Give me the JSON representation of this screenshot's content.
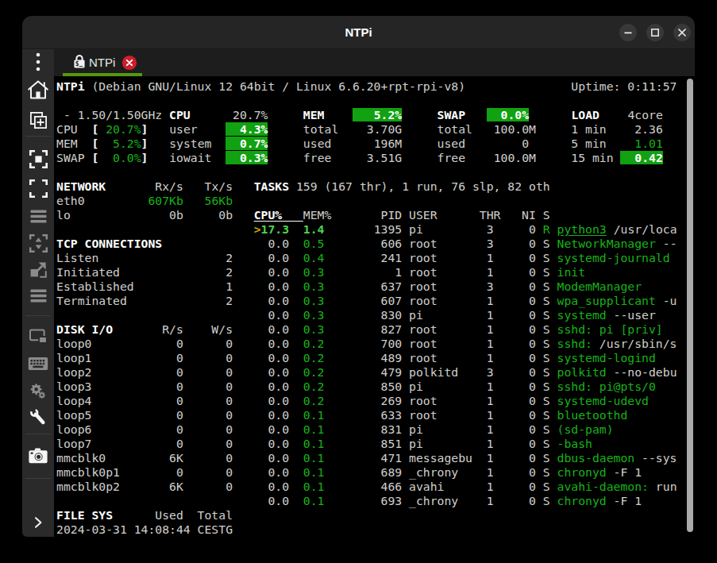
{
  "window": {
    "title": "NTPi"
  },
  "titlebar": {
    "buttons": [
      {
        "id": "minimize",
        "glyph": "minus"
      },
      {
        "id": "maximize",
        "glyph": "square"
      },
      {
        "id": "close",
        "glyph": "cross"
      }
    ]
  },
  "sidebar": {
    "tools": [
      {
        "id": "kebab-menu",
        "enabled": true
      },
      {
        "id": "home",
        "enabled": true
      },
      {
        "id": "duplicate-connection",
        "enabled": true
      },
      {
        "id": "fit-window",
        "enabled": true
      },
      {
        "id": "fullscreen",
        "enabled": true
      },
      {
        "id": "multi-monitor-lines",
        "enabled": false
      },
      {
        "id": "dynamic-resolution",
        "enabled": false
      },
      {
        "id": "scaled-mode",
        "enabled": false
      },
      {
        "id": "keystrokes-lines",
        "enabled": false
      },
      {
        "id": "switch-tab-pages",
        "enabled": false
      },
      {
        "id": "grab-keyboard",
        "enabled": false
      },
      {
        "id": "preferences-gears",
        "enabled": false
      },
      {
        "id": "tools-wrench",
        "enabled": true
      },
      {
        "id": "screenshot-camera",
        "enabled": true
      },
      {
        "id": "collapse-toolbar-chevron",
        "enabled": true
      }
    ]
  },
  "tabbar": {
    "tabs": [
      {
        "label": "NTPi",
        "icon": "ssh-lock",
        "active": true
      }
    ]
  },
  "terminal": {
    "columns": 88,
    "visible_rows": 32,
    "palette": {
      "background": "#000000",
      "foreground": "#d0cfcc",
      "bold_white": "#ffffff",
      "green": "#18b218",
      "bright_green": "#4fd34f",
      "yellow": "#c8a400",
      "green_background": "#11a111"
    },
    "lines": [
      [
        [
          "w",
          "NTPi"
        ],
        [
          "d",
          " (Debian GNU/Linux 12 64bit / Linux 6.6.20+rpt-rpi-v8)               Uptime: 0:11:57"
        ]
      ],
      [],
      [
        [
          "d",
          " - 1.50/1.50GHz "
        ],
        [
          "w",
          "CPU"
        ],
        [
          "d",
          "      20.7%     "
        ],
        [
          "w",
          "MEM"
        ],
        [
          "d",
          "    "
        ],
        [
          "B",
          "   5.2%"
        ],
        [
          "d",
          "     "
        ],
        [
          "w",
          "SWAP"
        ],
        [
          "d",
          "   "
        ],
        [
          "B",
          "  0.0%"
        ],
        [
          "d",
          "      "
        ],
        [
          "w",
          "LOAD"
        ],
        [
          "d",
          "    4core"
        ]
      ],
      [
        [
          "d",
          "CPU  "
        ],
        [
          "w",
          "["
        ],
        [
          "d",
          " "
        ],
        [
          "g",
          "20.7%"
        ],
        [
          "w",
          "]"
        ],
        [
          "d",
          "   user    "
        ],
        [
          "B",
          "  4.3%"
        ],
        [
          "d",
          "     total    3.70G     total   100.0M     1 min    2.36"
        ]
      ],
      [
        [
          "d",
          "MEM  "
        ],
        [
          "w",
          "["
        ],
        [
          "d",
          "  "
        ],
        [
          "g",
          "5.2%"
        ],
        [
          "w",
          "]"
        ],
        [
          "d",
          "   system  "
        ],
        [
          "B",
          "  0.7%"
        ],
        [
          "d",
          "     used      196M     used        0      5 min    "
        ],
        [
          "g",
          "1.01"
        ]
      ],
      [
        [
          "d",
          "SWAP "
        ],
        [
          "w",
          "["
        ],
        [
          "d",
          "  "
        ],
        [
          "g",
          "0.0%"
        ],
        [
          "w",
          "]"
        ],
        [
          "d",
          "   iowait  "
        ],
        [
          "B",
          "  0.3%"
        ],
        [
          "d",
          "     free     3.51G     free    100.0M     15 min "
        ],
        [
          "B",
          "  0.42"
        ]
      ],
      [],
      [
        [
          "w",
          "NETWORK"
        ],
        [
          "d",
          "       Rx/s   Tx/s   "
        ],
        [
          "w",
          "TASKS"
        ],
        [
          "d",
          " 159 (167 thr), 1 run, 76 slp, 82 oth"
        ]
      ],
      [
        [
          "d",
          "eth0         "
        ],
        [
          "g",
          "607Kb"
        ],
        [
          "d",
          "   "
        ],
        [
          "g",
          "56Kb"
        ]
      ],
      [
        [
          "d",
          "lo              0b     0b   "
        ],
        [
          "hu",
          "CPU%   "
        ],
        [
          "d",
          "MEM%       PID USER      THR   NI S"
        ]
      ],
      [
        [
          "d",
          "                            "
        ],
        [
          "y",
          ">"
        ],
        [
          "G",
          "17.3"
        ],
        [
          "d",
          "  "
        ],
        [
          "G",
          "1.4"
        ],
        [
          "d",
          "       1395 pi         3     0 "
        ],
        [
          "g",
          "R"
        ],
        [
          "d",
          " "
        ],
        [
          "gu",
          "python3"
        ],
        [
          "d",
          " /usr/loca"
        ]
      ],
      [
        [
          "w",
          "TCP CONNECTIONS"
        ],
        [
          "d",
          "               0.0  "
        ],
        [
          "g",
          "0.5"
        ],
        [
          "d",
          "        606 root       3     0 S "
        ],
        [
          "g",
          "NetworkManager"
        ],
        [
          "d",
          " --"
        ]
      ],
      [
        [
          "d",
          "Listen                  2     0.0  "
        ],
        [
          "g",
          "0.4"
        ],
        [
          "d",
          "        241 root       1     0 S "
        ],
        [
          "g",
          "systemd-journald"
        ]
      ],
      [
        [
          "d",
          "Initiated               2     0.0  "
        ],
        [
          "g",
          "0.3"
        ],
        [
          "d",
          "          1 root       1     0 S "
        ],
        [
          "g",
          "init"
        ]
      ],
      [
        [
          "d",
          "Established             1     0.0  "
        ],
        [
          "g",
          "0.3"
        ],
        [
          "d",
          "        637 root       3     0 S "
        ],
        [
          "g",
          "ModemManager"
        ]
      ],
      [
        [
          "d",
          "Terminated              2     0.0  "
        ],
        [
          "g",
          "0.3"
        ],
        [
          "d",
          "        607 root       1     0 S "
        ],
        [
          "g",
          "wpa_supplicant"
        ],
        [
          "d",
          " -u"
        ]
      ],
      [
        [
          "d",
          "                              0.0  "
        ],
        [
          "g",
          "0.3"
        ],
        [
          "d",
          "        830 pi         1     0 S "
        ],
        [
          "g",
          "systemd"
        ],
        [
          "d",
          " --user"
        ]
      ],
      [
        [
          "w",
          "DISK I/O"
        ],
        [
          "d",
          "       R/s    W/s     0.0  "
        ],
        [
          "g",
          "0.3"
        ],
        [
          "d",
          "        827 root       1     0 S "
        ],
        [
          "g",
          "sshd: pi [priv]"
        ]
      ],
      [
        [
          "d",
          "loop0            0      0     0.0  "
        ],
        [
          "g",
          "0.2"
        ],
        [
          "d",
          "        700 root       1     0 S "
        ],
        [
          "g",
          "sshd:"
        ],
        [
          "d",
          " /usr/sbin/s"
        ]
      ],
      [
        [
          "d",
          "loop1            0      0     0.0  "
        ],
        [
          "g",
          "0.2"
        ],
        [
          "d",
          "        489 root       1     0 S "
        ],
        [
          "g",
          "systemd-logind"
        ]
      ],
      [
        [
          "d",
          "loop2            0      0     0.0  "
        ],
        [
          "g",
          "0.2"
        ],
        [
          "d",
          "        479 polkitd    3     0 S "
        ],
        [
          "g",
          "polkitd"
        ],
        [
          "d",
          " --no-debu"
        ]
      ],
      [
        [
          "d",
          "loop3            0      0     0.0  "
        ],
        [
          "g",
          "0.2"
        ],
        [
          "d",
          "        850 pi         1     0 S "
        ],
        [
          "g",
          "sshd: pi@pts/0"
        ]
      ],
      [
        [
          "d",
          "loop4            0      0     0.0  "
        ],
        [
          "g",
          "0.2"
        ],
        [
          "d",
          "        269 root       1     0 S "
        ],
        [
          "g",
          "systemd-udevd"
        ]
      ],
      [
        [
          "d",
          "loop5            0      0     0.0  "
        ],
        [
          "g",
          "0.1"
        ],
        [
          "d",
          "        633 root       1     0 S "
        ],
        [
          "g",
          "bluetoothd"
        ]
      ],
      [
        [
          "d",
          "loop6            0      0     0.0  "
        ],
        [
          "g",
          "0.1"
        ],
        [
          "d",
          "        831 pi         1     0 S "
        ],
        [
          "g",
          "(sd-pam)"
        ]
      ],
      [
        [
          "d",
          "loop7            0      0     0.0  "
        ],
        [
          "g",
          "0.1"
        ],
        [
          "d",
          "        851 pi         1     0 S "
        ],
        [
          "g",
          "-bash"
        ]
      ],
      [
        [
          "d",
          "mmcblk0         6K      0     0.0  "
        ],
        [
          "g",
          "0.1"
        ],
        [
          "d",
          "        471 messagebu  1     0 S "
        ],
        [
          "g",
          "dbus-daemon"
        ],
        [
          "d",
          " --sys"
        ]
      ],
      [
        [
          "d",
          "mmcblk0p1        0      0     0.0  "
        ],
        [
          "g",
          "0.1"
        ],
        [
          "d",
          "        689 _chrony    1     0 S "
        ],
        [
          "g",
          "chronyd"
        ],
        [
          "d",
          " -F 1"
        ]
      ],
      [
        [
          "d",
          "mmcblk0p2       6K      0     0.0  "
        ],
        [
          "g",
          "0.1"
        ],
        [
          "d",
          "        466 avahi      1     0 S "
        ],
        [
          "g",
          "avahi-daemon:"
        ],
        [
          "d",
          " run"
        ]
      ],
      [
        [
          "d",
          "                              0.0  "
        ],
        [
          "g",
          "0.1"
        ],
        [
          "d",
          "        693 _chrony    1     0 S "
        ],
        [
          "g",
          "chronyd"
        ],
        [
          "d",
          " -F 1"
        ]
      ],
      [
        [
          "w",
          "FILE SYS"
        ],
        [
          "d",
          "      Used  Total"
        ]
      ],
      [
        [
          "d",
          "2024-03-31 14:08:44 CESTG"
        ]
      ]
    ]
  },
  "scrollbar": {
    "position": "right",
    "thumb_color": "#b8b8b8"
  },
  "accent": {
    "tab_underline": "#55980f",
    "close_tab_red": "#cc1f2d"
  }
}
